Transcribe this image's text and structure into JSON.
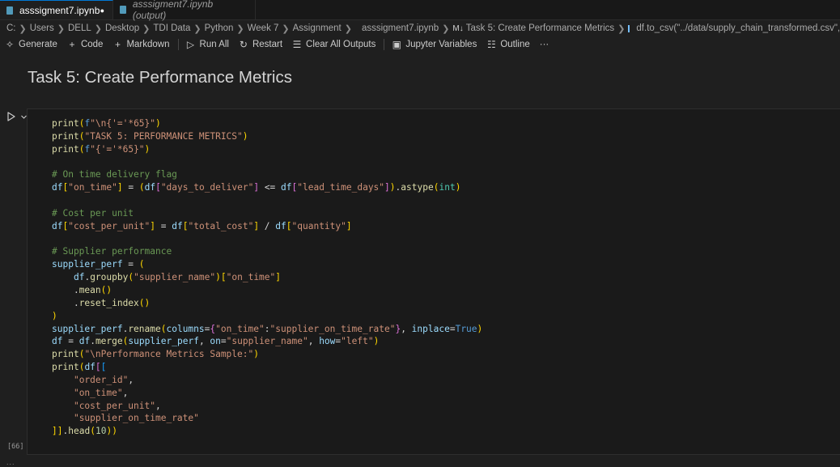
{
  "tabs": [
    {
      "label": "asssigment7.ipynb",
      "modified": "●"
    },
    {
      "label": "asssigment7.ipynb (output)"
    }
  ],
  "breadcrumb": {
    "items": [
      "C:",
      "Users",
      "DELL",
      "Desktop",
      "TDI Data",
      "Python",
      "Week 7",
      "Assignment"
    ],
    "file": "asssigment7.ipynb",
    "md_prefix": "M↓",
    "cell": "Task 5: Create Performance Metrics",
    "symbol": "df.to_csv(\"../data/supply_chain_transformed.csv\", index=False)"
  },
  "toolbar": {
    "generate": "Generate",
    "code": "Code",
    "markdown": "Markdown",
    "run_all": "Run All",
    "restart": "Restart",
    "clear_all_outputs": "Clear All Outputs",
    "jupyter_variables": "Jupyter Variables",
    "outline": "Outline",
    "more": "···"
  },
  "markdown_cell": {
    "title": "Task 5: Create Performance Metrics"
  },
  "code_cell": {
    "execution_count": "[66]",
    "lines": [
      "print(f\"\\n{'='*65}\")",
      "print(\"TASK 5: PERFORMANCE METRICS\")",
      "print(f\"{'='*65}\")",
      "",
      "# On time delivery flag",
      "df[\"on_time\"] = (df[\"days_to_deliver\"] <= df[\"lead_time_days\"]).astype(int)",
      "",
      "# Cost per unit",
      "df[\"cost_per_unit\"] = df[\"total_cost\"] / df[\"quantity\"]",
      "",
      "# Supplier performance",
      "supplier_perf = (",
      "    df.groupby(\"supplier_name\")[\"on_time\"]",
      "    .mean()",
      "    .reset_index()",
      ")",
      "supplier_perf.rename(columns={\"on_time\":\"supplier_on_time_rate\"}, inplace=True)",
      "df = df.merge(supplier_perf, on=\"supplier_name\", how=\"left\")",
      "print(\"\\nPerformance Metrics Sample:\")",
      "print(df[[",
      "    \"order_id\",",
      "    \"on_time\",",
      "    \"cost_per_unit\",",
      "    \"supplier_on_time_rate\"",
      "]].head(10))"
    ]
  },
  "colors": {
    "background": "#1f1f1f",
    "active_tab_accent": "#0078d4",
    "string": "#ce9178",
    "function": "#dcdcaa",
    "variable": "#9cdcfe",
    "comment": "#6a9955",
    "keyword": "#569cd6"
  }
}
